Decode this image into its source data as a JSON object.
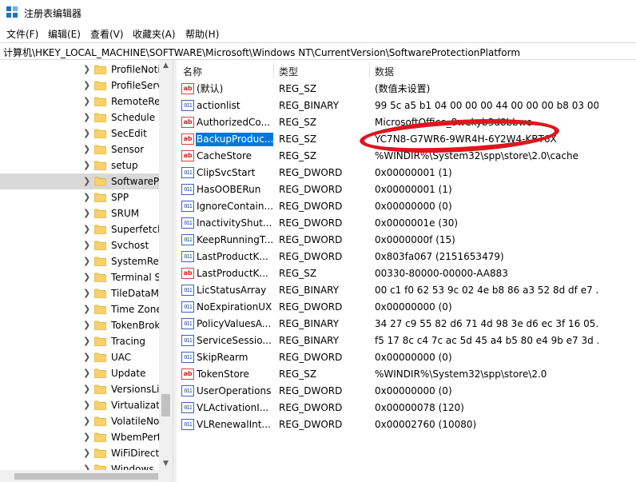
{
  "window": {
    "title": "注册表编辑器"
  },
  "menu": [
    "文件(F)",
    "编辑(E)",
    "查看(V)",
    "收藏夹(A)",
    "帮助(H)"
  ],
  "address": "计算机\\HKEY_LOCAL_MACHINE\\SOFTWARE\\Microsoft\\Windows NT\\CurrentVersion\\SoftwareProtectionPlatform",
  "tree": {
    "items": [
      "ProfileNotification",
      "ProfileService",
      "RemoteRegistry",
      "Schedule",
      "SecEdit",
      "Sensor",
      "setup",
      "SoftwareProtectionPlatform",
      "SPP",
      "SRUM",
      "Superfetch",
      "Svchost",
      "SystemRestore",
      "Terminal Server",
      "TileDataModel",
      "Time Zones",
      "TokenBroker",
      "Tracing",
      "UAC",
      "Update",
      "VersionsList",
      "Virtualization",
      "VolatileNotifications",
      "WbemPerf",
      "WiFiDirectAPI",
      "Windows"
    ],
    "selected_index": 7
  },
  "columns": {
    "name": "名称",
    "type": "类型",
    "data": "数据"
  },
  "rows": [
    {
      "name": "(默认)",
      "type": "REG_SZ",
      "data": "(数值未设置)",
      "icon": "string-value-icon"
    },
    {
      "name": "actionlist",
      "type": "REG_BINARY",
      "data": "99 5c a5 b1 04 00 00 00 44 00 00 00 b8 03 00...",
      "icon": "binary-value-icon"
    },
    {
      "name": "AuthorizedContainers",
      "type": "REG_SZ",
      "data": "MicrosoftOffice_8wekyb3d8bbwe",
      "icon": "string-value-icon"
    },
    {
      "name": "BackupProductKeyDefault",
      "type": "REG_SZ",
      "data": "YC7N8-G7WR6-9WR4H-6Y2W4-KBT6X",
      "icon": "string-value-icon"
    },
    {
      "name": "CacheStore",
      "type": "REG_SZ",
      "data": "%WINDIR%\\System32\\spp\\store\\2.0\\cache",
      "icon": "string-value-icon"
    },
    {
      "name": "ClipSvcStart",
      "type": "REG_DWORD",
      "data": "0x00000001 (1)",
      "icon": "binary-value-icon"
    },
    {
      "name": "HasOOBERun",
      "type": "REG_DWORD",
      "data": "0x00000001 (1)",
      "icon": "binary-value-icon"
    },
    {
      "name": "IgnoreContainerOrigin",
      "type": "REG_DWORD",
      "data": "0x00000000 (0)",
      "icon": "binary-value-icon"
    },
    {
      "name": "InactivityShutdownDelay",
      "type": "REG_DWORD",
      "data": "0x0000001e (30)",
      "icon": "binary-value-icon"
    },
    {
      "name": "KeepRunningThresholdMins",
      "type": "REG_DWORD",
      "data": "0x0000000f (15)",
      "icon": "binary-value-icon"
    },
    {
      "name": "LastProductKeyHash",
      "type": "REG_DWORD",
      "data": "0x803fa067 (2151653479)",
      "icon": "binary-value-icon"
    },
    {
      "name": "LastProductKeyId",
      "type": "REG_SZ",
      "data": "00330-80000-00000-AA883",
      "icon": "string-value-icon"
    },
    {
      "name": "LicStatusArray",
      "type": "REG_BINARY",
      "data": "00 c1 f0 62 53 9c 02 4e b8 86 a3 52 8d df e7 ...",
      "icon": "binary-value-icon"
    },
    {
      "name": "NoExpirationUX",
      "type": "REG_DWORD",
      "data": "0x00000000 (0)",
      "icon": "binary-value-icon"
    },
    {
      "name": "PolicyValuesArray",
      "type": "REG_BINARY",
      "data": "34 27 c9 55 82 d6 71 4d 98 3e d6 ec 3f 16 05...",
      "icon": "binary-value-icon"
    },
    {
      "name": "ServiceSessionId",
      "type": "REG_BINARY",
      "data": "f5 17 8c c4 7c ac 5d 45 a4 b5 80 e4 9b e7 3d ...",
      "icon": "binary-value-icon"
    },
    {
      "name": "SkipRearm",
      "type": "REG_DWORD",
      "data": "0x00000000 (0)",
      "icon": "binary-value-icon"
    },
    {
      "name": "TokenStore",
      "type": "REG_SZ",
      "data": "%WINDIR%\\System32\\spp\\store\\2.0",
      "icon": "string-value-icon"
    },
    {
      "name": "UserOperations",
      "type": "REG_DWORD",
      "data": "0x00000000 (0)",
      "icon": "binary-value-icon"
    },
    {
      "name": "VLActivationInterval",
      "type": "REG_DWORD",
      "data": "0x00000078 (120)",
      "icon": "binary-value-icon"
    },
    {
      "name": "VLRenewalInterval",
      "type": "REG_DWORD",
      "data": "0x00002760 (10080)",
      "icon": "binary-value-icon"
    }
  ],
  "selected_row_index": 3,
  "colors": {
    "selection": "#0078d7",
    "annotation": "#e0141e",
    "tree_selection": "#d9d9d9"
  },
  "icons": {
    "string": "ab",
    "binary": "011"
  }
}
